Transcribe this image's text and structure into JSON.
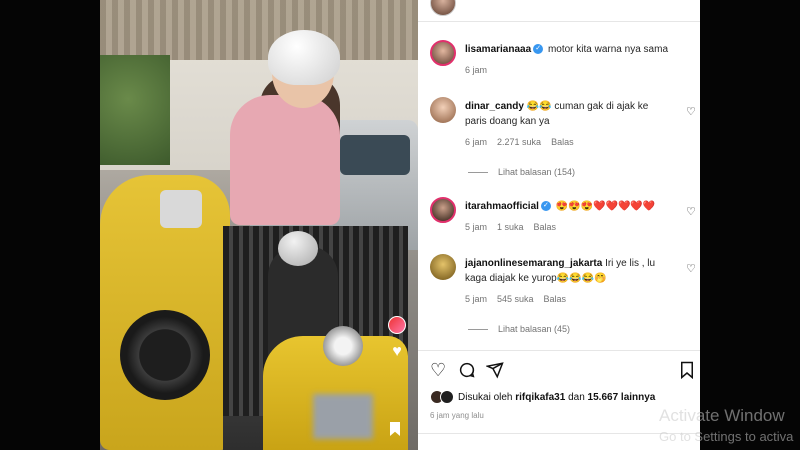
{
  "post": {
    "top_username": "lisamarianaaa"
  },
  "comments": [
    {
      "username": "lisamarianaaa",
      "verified": true,
      "text": "motor kita warna nya sama",
      "time": "6 jam",
      "likes": "",
      "reply_label": ""
    },
    {
      "username": "dinar_candy",
      "verified": false,
      "text": "😂😂 cuman gak di ajak ke paris doang kan ya",
      "time": "6 jam",
      "likes": "2.271 suka",
      "reply_label": "Balas",
      "view_replies": "Lihat balasan (154)"
    },
    {
      "username": "itarahmaofficial",
      "verified": true,
      "text": "😍😍😍❤️❤️❤️❤️❤️",
      "time": "5 jam",
      "likes": "1 suka",
      "reply_label": "Balas"
    },
    {
      "username": "jajanonlinesemarang_jakarta",
      "verified": false,
      "text": "Iri ye lis , lu kaga diajak ke yurop😂😂😂🤭",
      "time": "5 jam",
      "likes": "545 suka",
      "reply_label": "Balas",
      "view_replies": "Lihat balasan (45)"
    }
  ],
  "actions": {
    "like_icon": "heart-icon",
    "comment_icon": "comment-icon",
    "share_icon": "send-icon",
    "save_icon": "bookmark-icon"
  },
  "likes_summary": {
    "prefix": "Disukai oleh",
    "user": "rifqikafa31",
    "middle": "dan",
    "count": "15.667 lainnya"
  },
  "time_ago": "6 jam yang lalu",
  "watermark": {
    "title": "Activate Window",
    "subtitle": "Go to Settings to activa"
  },
  "colors": {
    "verified": "#3897f0",
    "panel_bg": "#ffffff",
    "scooter_yellow": "#e6c437"
  }
}
